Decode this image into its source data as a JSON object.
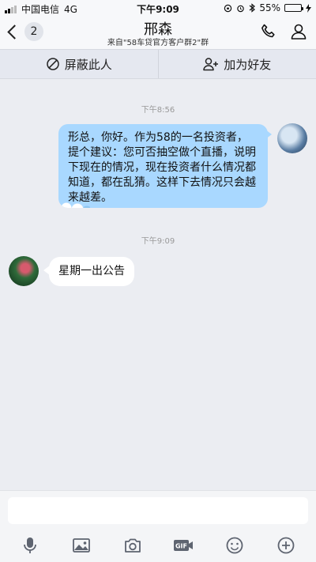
{
  "status_bar": {
    "carrier": "中国电信",
    "network": "4G",
    "time": "下午9:09",
    "battery": "55%",
    "battery_level": 0.55
  },
  "header": {
    "back_badge": "2",
    "title": "邢森",
    "subtitle": "来自\"58车贷官方客户群2\"群"
  },
  "actions": {
    "block_label": "屏蔽此人",
    "add_friend_label": "加为好友"
  },
  "chat": {
    "messages": [
      {
        "timestamp": "下午8:56",
        "sender": "me",
        "text": "形总，你好。作为58的一名投资者，提个建议：您可否抽空做个直播，说明下现在的情况，现在投资者什么情况都知道，都在乱猜。这样下去情况只会越来越差。"
      },
      {
        "timestamp": "下午9:09",
        "sender": "other",
        "text": "星期一出公告"
      }
    ]
  },
  "input": {
    "value": "",
    "placeholder": ""
  },
  "colors": {
    "sent_bubble": "#a9d8ff",
    "received_bubble": "#ffffff",
    "background": "#ebedf2"
  },
  "icons": [
    "back-chevron-icon",
    "phone-icon",
    "profile-icon",
    "block-icon",
    "add-friend-icon",
    "microphone-icon",
    "image-icon",
    "camera-icon",
    "gif-icon",
    "emoji-icon",
    "plus-icon"
  ]
}
